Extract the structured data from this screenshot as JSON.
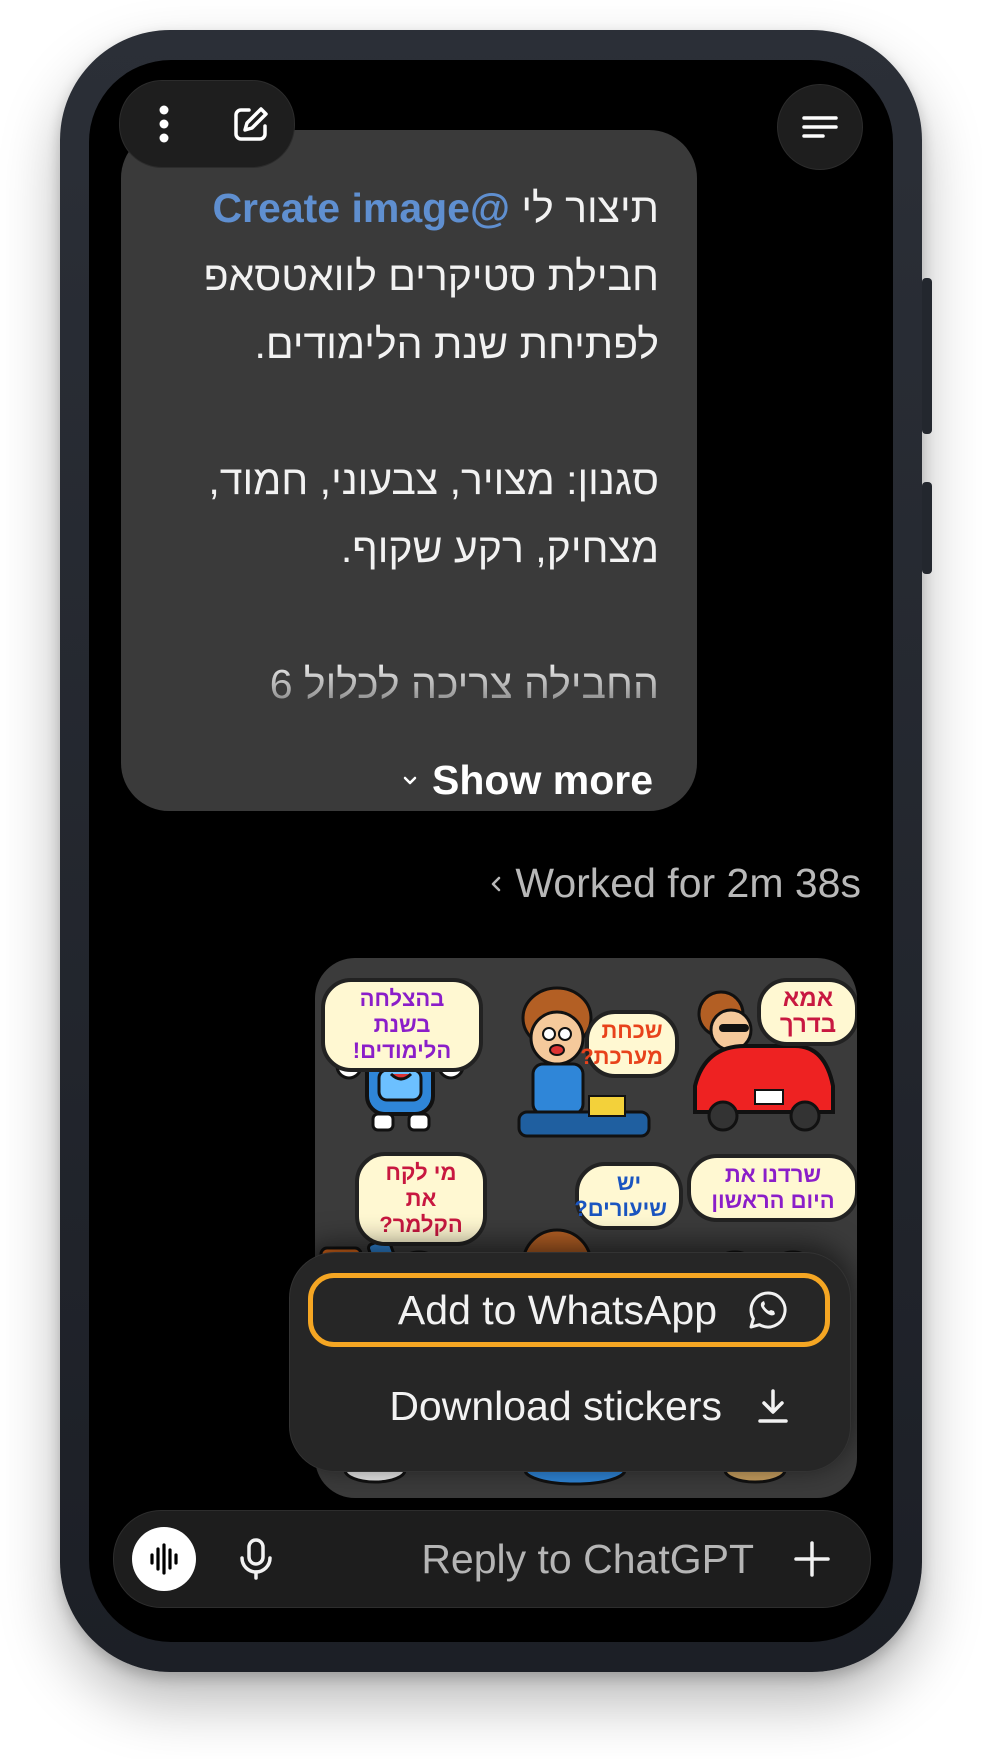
{
  "header": {
    "more_icon": "more-vertical-icon",
    "edit_icon": "edit-pencil-icon",
    "menu_icon": "menu-lines-icon"
  },
  "user_message": {
    "mention": "@Create image",
    "text_part1": "תיצור לי",
    "text_rest": "חבילת סטיקרים לוואטסאפ\nלפתיחת שנת הלימודים.\n\nסגנון: מצויר, צבעוני, חמוד,\nמצחיק, רקע שקוף.\n\nהחבילה צריכה לכלול 6",
    "show_more": "Show more"
  },
  "worked_for": "Worked for 2m 38s",
  "stickers": [
    {
      "caption": "בהצלחה בשנת הלימודים!"
    },
    {
      "caption": "שכחת מערכת?"
    },
    {
      "caption": "אמא בדרך"
    },
    {
      "caption": "מי לקח את הקלמר?"
    },
    {
      "caption": "יש שיעורים?"
    },
    {
      "caption": "שרדנו את היום הראשון"
    }
  ],
  "sticker_menu": {
    "add_to_whatsapp": "Add to WhatsApp",
    "download_stickers": "Download stickers"
  },
  "composer": {
    "placeholder": "Reply to ChatGPT"
  },
  "colors": {
    "accent_highlight": "#f5a623",
    "mention": "#5f8fd0",
    "bubble": "#3a3a3a",
    "screen_bg": "#000000"
  }
}
